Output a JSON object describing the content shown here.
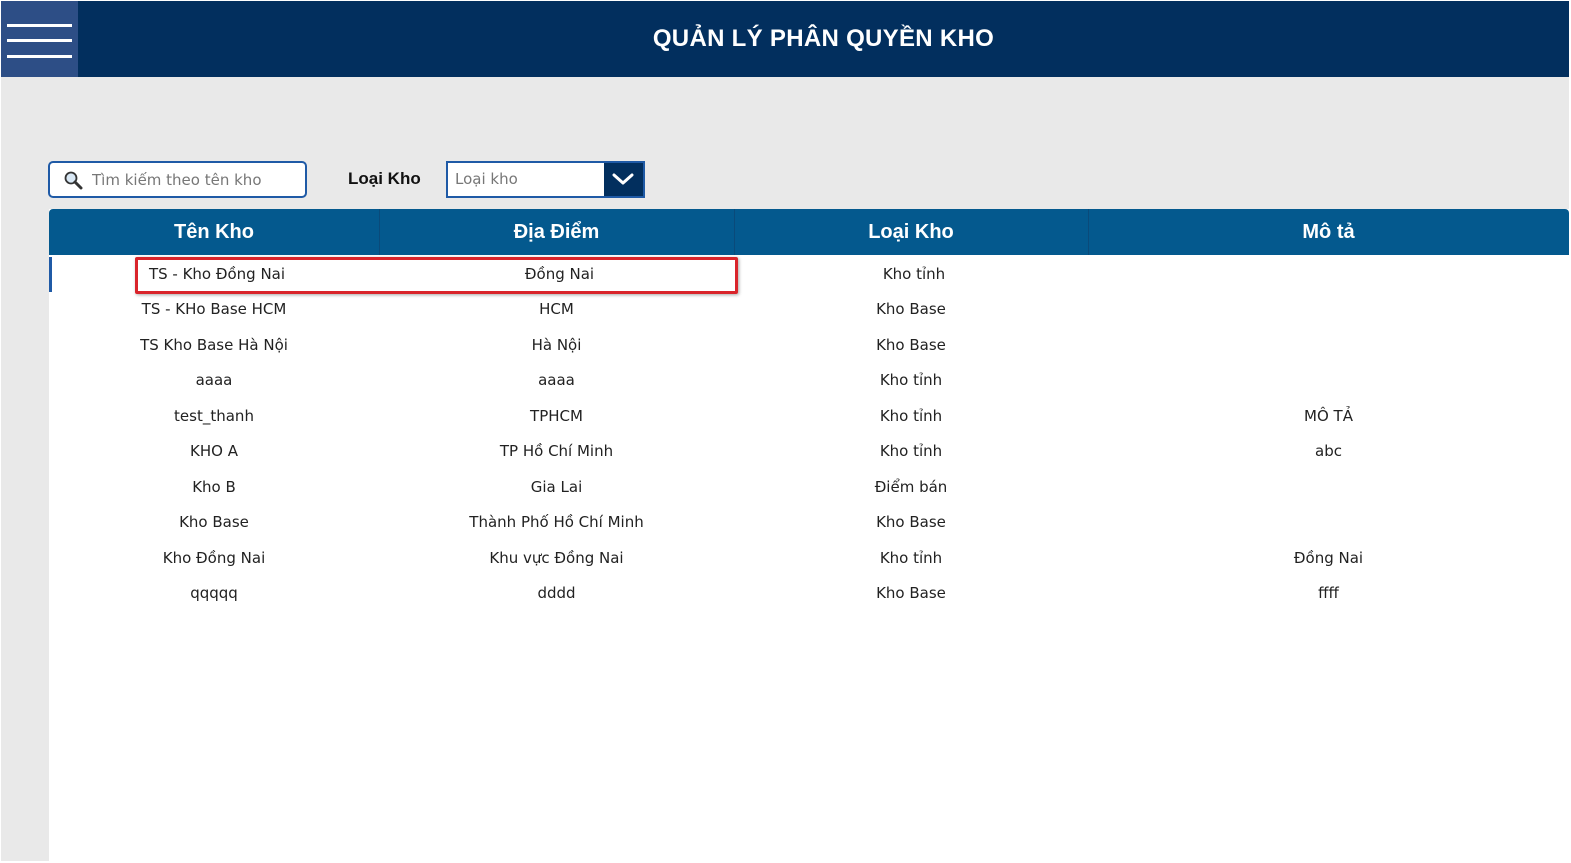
{
  "header": {
    "title": "QUẢN LÝ PHÂN QUYỀN KHO",
    "menu_icon": "hamburger-menu-icon"
  },
  "filters": {
    "search_placeholder": "Tìm kiếm theo tên kho",
    "search_value": "",
    "search_icon": "magnifier-icon",
    "type_label": "Loại Kho",
    "type_select_value": "Loại kho",
    "type_select_icon": "chevron-down-icon"
  },
  "table": {
    "columns": [
      "Tên Kho",
      "Địa Điểm",
      "Loại Kho",
      "Mô tả"
    ],
    "rows": [
      [
        "TS - Kho Đồng Nai",
        "Đồng Nai",
        "Kho tỉnh",
        ""
      ],
      [
        "TS - KHo Base HCM",
        "HCM",
        "Kho Base",
        ""
      ],
      [
        "TS Kho Base Hà Nội",
        "Hà Nội",
        "Kho Base",
        ""
      ],
      [
        "aaaa",
        "aaaa",
        "Kho tỉnh",
        ""
      ],
      [
        "test_thanh",
        "TPHCM",
        "Kho tỉnh",
        "MÔ TẢ"
      ],
      [
        "KHO A",
        "TP Hồ Chí Minh",
        "Kho tỉnh",
        "abc"
      ],
      [
        "Kho B",
        "Gia Lai",
        "Điểm bán",
        ""
      ],
      [
        "Kho Base",
        "Thành Phố Hồ Chí Minh",
        "Kho Base",
        ""
      ],
      [
        "Kho Đồng Nai",
        "Khu vực Đồng Nai",
        "Kho tỉnh",
        "Đồng Nai"
      ],
      [
        "qqqqq",
        "dddd",
        "Kho Base",
        "ffff"
      ]
    ],
    "selected_row": 0
  },
  "colors": {
    "header_bg": "#022f5e",
    "menu_bg": "#2d4e86",
    "table_header_bg": "#04598e",
    "highlight": "#d9242b"
  }
}
